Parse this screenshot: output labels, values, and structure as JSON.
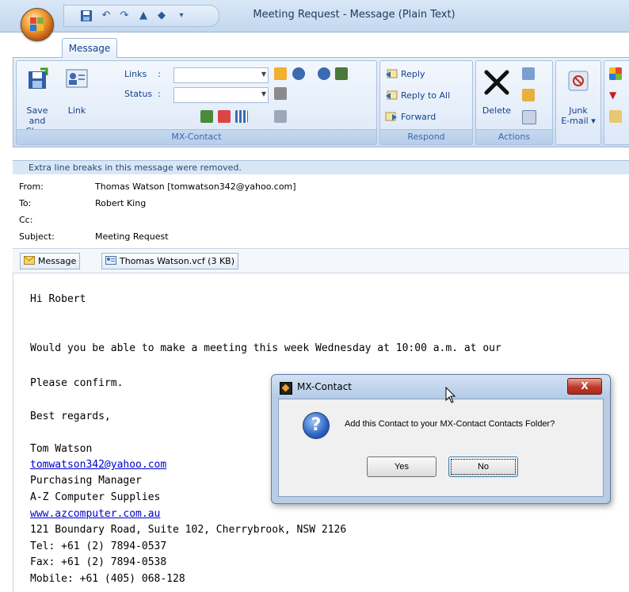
{
  "window": {
    "title": "Meeting Request - Message (Plain Text)"
  },
  "tabs": [
    "Message"
  ],
  "ribbon": {
    "save_close_label": [
      "Save and",
      "Close"
    ],
    "link_label": "Link",
    "links_label": "Links",
    "status_label": "Status",
    "mx_group": "MX-Contact",
    "respond": {
      "reply": "Reply",
      "reply_all": "Reply to All",
      "forward": "Forward",
      "group": "Respond"
    },
    "actions": {
      "delete": "Delete",
      "group": "Actions"
    },
    "junk": [
      "Junk",
      "E-mail"
    ]
  },
  "info_bar": "Extra line breaks in this message were removed.",
  "headers": {
    "from_label": "From:",
    "from": "Thomas Watson [tomwatson342@yahoo.com]",
    "to_label": "To:",
    "to": "Robert King",
    "cc_label": "Cc:",
    "subject_label": "Subject:",
    "subject": "Meeting Request"
  },
  "attachments": {
    "message_tab": "Message",
    "file": "Thomas Watson.vcf (3 KB)"
  },
  "body": {
    "greeting": "Hi Robert",
    "line1": "Would you be able to make a meeting this week Wednesday at 10:00 a.m. at our",
    "line2": "Please confirm.",
    "line3": "Best regards,",
    "sig_name": "Tom Watson",
    "sig_email": "tomwatson342@yahoo.com",
    "sig_title": "Purchasing Manager",
    "sig_company": "A-Z Computer Supplies",
    "sig_web": "www.azcomputer.com.au",
    "sig_address": "121 Boundary Road, Suite 102, Cherrybrook, NSW 2126",
    "sig_tel": "Tel: +61 (2) 7894-0537",
    "sig_fax": "Fax: +61 (2) 7894-0538",
    "sig_mobile": "Mobile: +61 (405) 068-128"
  },
  "dialog": {
    "title": "MX-Contact",
    "close": "X",
    "message": "Add this Contact to your MX-Contact Contacts Folder?",
    "yes": "Yes",
    "no": "No"
  }
}
